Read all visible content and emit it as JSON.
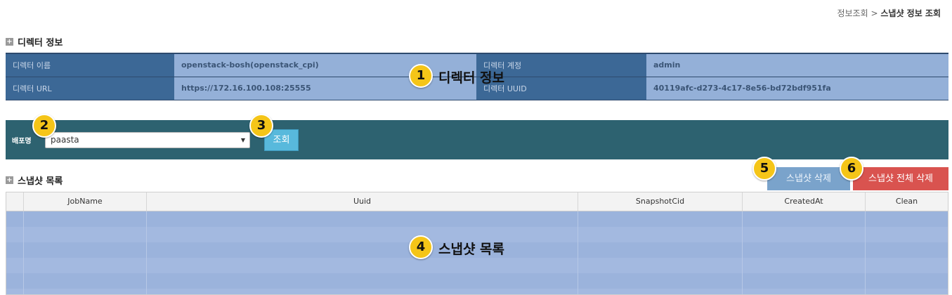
{
  "breadcrumb": {
    "parent": "정보조회",
    "sep": ">",
    "current": "스냅샷 정보 조회"
  },
  "director_section": {
    "title": "디렉터 정보",
    "rows": [
      {
        "label1": "디렉터 이름",
        "value1": "openstack-bosh(openstack_cpi)",
        "label2": "디렉터 계정",
        "value2": "admin"
      },
      {
        "label1": "디렉터 URL",
        "value1": "https://172.16.100.108:25555",
        "label2": "디렉터 UUID",
        "value2": "40119afc-d273-4c17-8e56-bd72bdf951fa"
      }
    ]
  },
  "filter": {
    "label": "배포명",
    "selected": "paasta",
    "query_label": "조회"
  },
  "snapshot_section": {
    "title": "스냅샷 목록",
    "delete_label": "스냅샷 삭제",
    "delete_all_label": "스냅샷 전체 삭제",
    "columns": [
      "",
      "JobName",
      "Uuid",
      "SnapshotCid",
      "CreatedAt",
      "Clean"
    ]
  },
  "annotations": [
    {
      "num": "1",
      "text": "디렉터 정보"
    },
    {
      "num": "2",
      "text": ""
    },
    {
      "num": "3",
      "text": ""
    },
    {
      "num": "4",
      "text": "스냅샷 목록"
    },
    {
      "num": "5",
      "text": ""
    },
    {
      "num": "6",
      "text": ""
    }
  ],
  "colors": {
    "header_cell": "#3c6896",
    "value_cell": "#94b0d8",
    "filter_bar": "#2d6270",
    "query_button": "#58b9dc",
    "delete_button": "#7aa3cb",
    "delete_all_button": "#d9534f",
    "badge": "#f5c518"
  }
}
